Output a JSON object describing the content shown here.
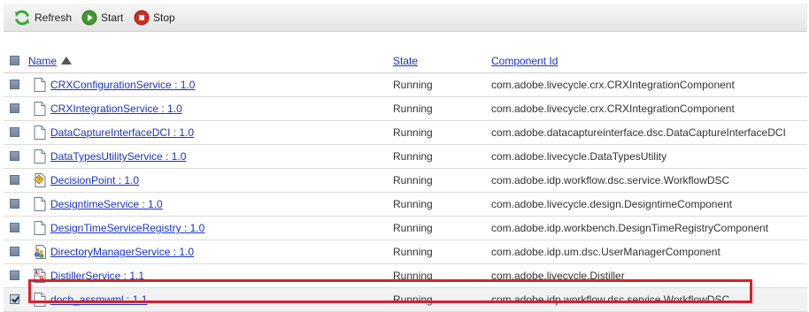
{
  "toolbar": {
    "refresh_label": "Refresh",
    "start_label": "Start",
    "stop_label": "Stop"
  },
  "table": {
    "columns": {
      "name": "Name",
      "state": "State",
      "component": "Component Id"
    },
    "sort": {
      "column": "Name",
      "direction": "ascending"
    },
    "rows": [
      {
        "name": "CRXConfigurationService : 1.0",
        "state": "Running",
        "component": "com.adobe.livecycle.crx.CRXIntegrationComponent",
        "icon": "document-icon",
        "checked": false
      },
      {
        "name": "CRXIntegrationService : 1.0",
        "state": "Running",
        "component": "com.adobe.livecycle.crx.CRXIntegrationComponent",
        "icon": "document-icon",
        "checked": false
      },
      {
        "name": "DataCaptureInterfaceDCI : 1.0",
        "state": "Running",
        "component": "com.adobe.datacaptureinterface.dsc.DataCaptureInterfaceDCI",
        "icon": "document-icon",
        "checked": false
      },
      {
        "name": "DataTypesUtilityService : 1.0",
        "state": "Running",
        "component": "com.adobe.livecycle.DataTypesUtility",
        "icon": "document-icon",
        "checked": false
      },
      {
        "name": "DecisionPoint : 1.0",
        "state": "Running",
        "component": "com.adobe.idp.workflow.dsc.service.WorkflowDSC",
        "icon": "decision-icon",
        "checked": false
      },
      {
        "name": "DesigntimeService : 1.0",
        "state": "Running",
        "component": "com.adobe.livecycle.design.DesigntimeComponent",
        "icon": "document-icon",
        "checked": false
      },
      {
        "name": "DesignTimeServiceRegistry : 1.0",
        "state": "Running",
        "component": "com.adobe.idp.workbench.DesignTimeRegistryComponent",
        "icon": "document-icon",
        "checked": false
      },
      {
        "name": "DirectoryManagerService : 1.0",
        "state": "Running",
        "component": "com.adobe.idp.um.dsc.UserManagerComponent",
        "icon": "directory-users-icon",
        "checked": false
      },
      {
        "name": "DistillerService : 1.1",
        "state": "Running",
        "component": "com.adobe.livecycle.Distiller",
        "icon": "pdf-document-icon",
        "checked": false
      },
      {
        "name": "docb_assmwml : 1.1",
        "state": "Running",
        "component": "com.adobe.idp.workflow.dsc.service.WorkflowDSC",
        "icon": "document-icon",
        "checked": true
      }
    ]
  },
  "colors": {
    "link": "#1a33c8",
    "highlight": "#d9202a",
    "refresh_icon": "#3aa83a",
    "start_icon": "#3d9a2c",
    "stop_icon": "#d22a1e"
  }
}
